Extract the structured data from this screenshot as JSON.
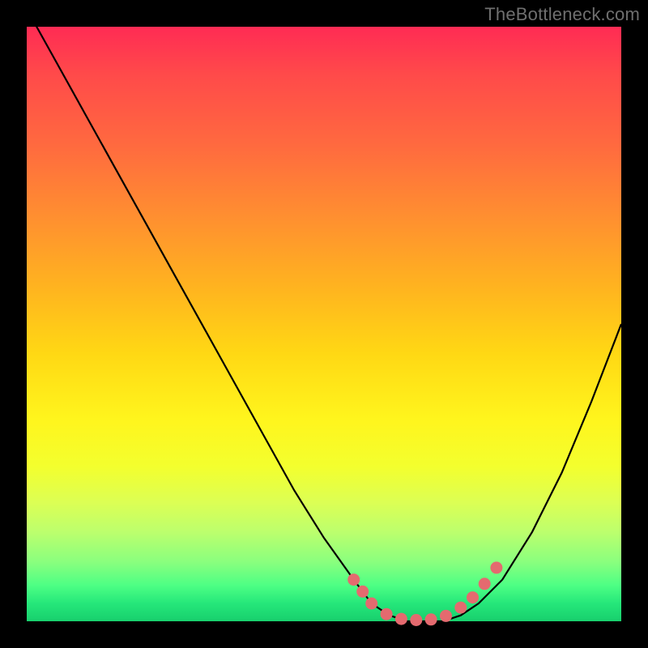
{
  "attribution": "TheBottleneck.com",
  "chart_data": {
    "type": "line",
    "title": "",
    "xlabel": "",
    "ylabel": "",
    "xlim": [
      0,
      100
    ],
    "ylim": [
      0,
      100
    ],
    "series": [
      {
        "name": "curve",
        "x": [
          0,
          5,
          10,
          15,
          20,
          25,
          30,
          35,
          40,
          45,
          50,
          55,
          58,
          61,
          64,
          67,
          70,
          73,
          76,
          80,
          85,
          90,
          95,
          100
        ],
        "y": [
          103,
          94,
          85,
          76,
          67,
          58,
          49,
          40,
          31,
          22,
          14,
          7,
          3,
          1,
          0,
          0,
          0,
          1,
          3,
          7,
          15,
          25,
          37,
          50
        ]
      }
    ],
    "markers": {
      "name": "highlighted-points",
      "color": "#e46a6f",
      "x": [
        55,
        56.5,
        58,
        60.5,
        63,
        65.5,
        68,
        70.5,
        73,
        75,
        77,
        79
      ],
      "y": [
        7,
        5,
        3,
        1.2,
        0.4,
        0.2,
        0.3,
        0.9,
        2.3,
        4,
        6.3,
        9
      ]
    },
    "background_gradient": {
      "top": "#ff2b54",
      "mid": "#ffe21a",
      "bottom": "#18cf6d"
    }
  }
}
